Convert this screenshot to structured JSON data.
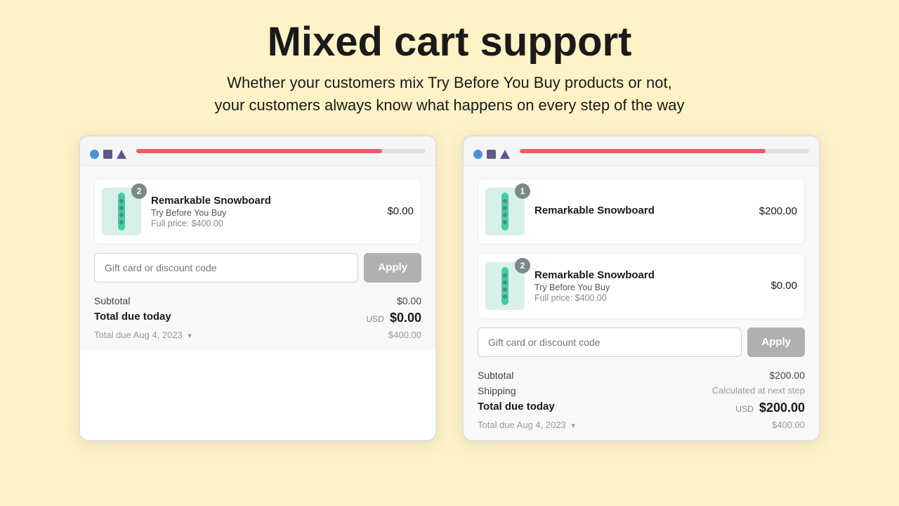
{
  "hero": {
    "title": "Mixed cart support",
    "subtitle_line1": "Whether your customers mix Try Before You Buy products or not,",
    "subtitle_line2": "your customers always know what happens on every step of the way"
  },
  "card_left": {
    "item": {
      "badge": "2",
      "name": "Remarkable Snowboard",
      "tag": "Try Before You Buy",
      "full_price": "Full price: $400.00",
      "price": "$0.00"
    },
    "discount_placeholder": "Gift card or discount code",
    "apply_label": "Apply",
    "subtotal_label": "Subtotal",
    "subtotal_value": "$0.00",
    "total_label": "Total due today",
    "total_usd": "USD",
    "total_value": "$0.00",
    "future_label": "Total due Aug 4, 2023",
    "future_value": "$400.00"
  },
  "card_right": {
    "item1": {
      "badge": "1",
      "name": "Remarkable Snowboard",
      "price": "$200.00"
    },
    "item2": {
      "badge": "2",
      "name": "Remarkable Snowboard",
      "tag": "Try Before You Buy",
      "full_price": "Full price: $400.00",
      "price": "$0.00"
    },
    "discount_placeholder": "Gift card or discount code",
    "apply_label": "Apply",
    "subtotal_label": "Subtotal",
    "subtotal_value": "$200.00",
    "shipping_label": "Shipping",
    "shipping_value": "Calculated at next step",
    "total_label": "Total due today",
    "total_usd": "USD",
    "total_value": "$200.00",
    "future_label": "Total due Aug 4, 2023",
    "future_value": "$400.00"
  }
}
